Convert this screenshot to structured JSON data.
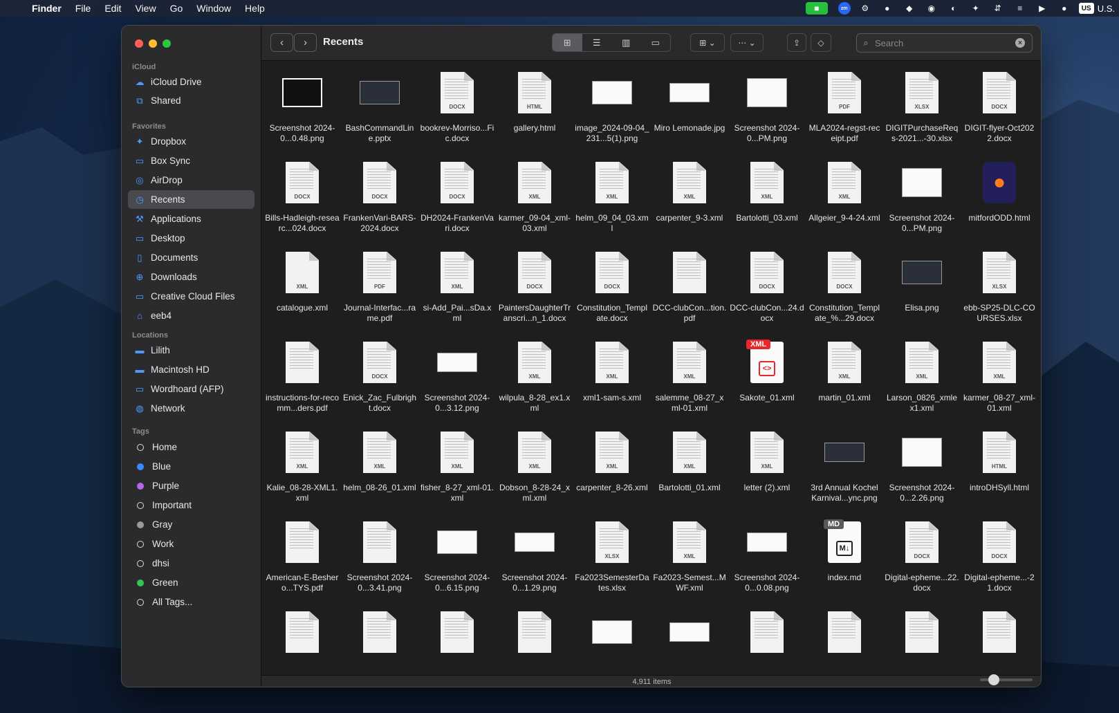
{
  "menubar": {
    "apple_icon": "apple-logo",
    "app_name": "Finder",
    "menus": [
      "File",
      "Edit",
      "View",
      "Go",
      "Window",
      "Help"
    ],
    "input_source": "U.S.",
    "input_badge": "US",
    "zoom_label": "zm"
  },
  "sidebar": {
    "icloud_title": "iCloud",
    "icloud": [
      {
        "label": "iCloud Drive",
        "icon": "☁"
      },
      {
        "label": "Shared",
        "icon": "⧉"
      }
    ],
    "favorites_title": "Favorites",
    "favorites": [
      {
        "label": "Dropbox",
        "icon": "✦"
      },
      {
        "label": "Box Sync",
        "icon": "▭"
      },
      {
        "label": "AirDrop",
        "icon": "◎"
      },
      {
        "label": "Recents",
        "icon": "◷",
        "selected": true
      },
      {
        "label": "Applications",
        "icon": "⚒"
      },
      {
        "label": "Desktop",
        "icon": "▭"
      },
      {
        "label": "Documents",
        "icon": "▯"
      },
      {
        "label": "Downloads",
        "icon": "⊕"
      },
      {
        "label": "Creative Cloud Files",
        "icon": "▭"
      },
      {
        "label": "eeb4",
        "icon": "⌂"
      }
    ],
    "locations_title": "Locations",
    "locations": [
      {
        "label": "Lilith",
        "icon": "▬"
      },
      {
        "label": "Macintosh HD",
        "icon": "▬"
      },
      {
        "label": "Wordhoard (AFP)",
        "icon": "▭"
      },
      {
        "label": "Network",
        "icon": "◍"
      }
    ],
    "tags_title": "Tags",
    "tags": [
      {
        "label": "Home",
        "color": "hollow"
      },
      {
        "label": "Blue",
        "color": "blue"
      },
      {
        "label": "Purple",
        "color": "purple"
      },
      {
        "label": "Important",
        "color": "hollow"
      },
      {
        "label": "Gray",
        "color": "gray"
      },
      {
        "label": "Work",
        "color": "hollow"
      },
      {
        "label": "dhsi",
        "color": "hollow"
      },
      {
        "label": "Green",
        "color": "green"
      },
      {
        "label": "All Tags...",
        "color": "hollow"
      }
    ]
  },
  "toolbar": {
    "title": "Recents",
    "back_icon": "‹",
    "forward_icon": "›",
    "search_placeholder": "Search"
  },
  "files": [
    {
      "name": "Screenshot 2024-0...0.48.png",
      "kind": "img-blk"
    },
    {
      "name": "BashCommandLine.pptx",
      "kind": "img-dark"
    },
    {
      "name": "bookrev-Morriso...Fic.docx",
      "kind": "doc",
      "label": "DOCX"
    },
    {
      "name": "gallery.html",
      "kind": "doc",
      "label": "HTML"
    },
    {
      "name": "image_2024-09-04_231...5(1).png",
      "kind": "img"
    },
    {
      "name": "Miro Lemonade.jpg",
      "kind": "img"
    },
    {
      "name": "Screenshot 2024-0...PM.png",
      "kind": "img"
    },
    {
      "name": "MLA2024-regst-receipt.pdf",
      "kind": "doc",
      "label": "PDF"
    },
    {
      "name": "DIGITPurchaseReqs-2021...-30.xlsx",
      "kind": "doc",
      "label": "XLSX"
    },
    {
      "name": "DIGIT-flyer-Oct2022.docx",
      "kind": "doc",
      "label": "DOCX"
    },
    {
      "name": "Bills-Hadleigh-researc...024.docx",
      "kind": "doc",
      "label": "DOCX"
    },
    {
      "name": "FrankenVari-BARS-2024.docx",
      "kind": "doc",
      "label": "DOCX"
    },
    {
      "name": "DH2024-FrankenVari.docx",
      "kind": "doc",
      "label": "DOCX"
    },
    {
      "name": "karmer_09-04_xml-03.xml",
      "kind": "doc",
      "label": "XML"
    },
    {
      "name": "helm_09_04_03.xml",
      "kind": "doc",
      "label": "XML"
    },
    {
      "name": "carpenter_9-3.xml",
      "kind": "doc",
      "label": "XML"
    },
    {
      "name": "Bartolotti_03.xml",
      "kind": "doc",
      "label": "XML"
    },
    {
      "name": "Allgeier_9-4-24.xml",
      "kind": "doc",
      "label": "XML"
    },
    {
      "name": "Screenshot 2024-0...PM.png",
      "kind": "img"
    },
    {
      "name": "mitfordODD.html",
      "kind": "fx"
    },
    {
      "name": "catalogue.xml",
      "kind": "doc-plain",
      "label": "XML"
    },
    {
      "name": "Journal-Interfac...rame.pdf",
      "kind": "doc",
      "label": "PDF"
    },
    {
      "name": "si-Add_Pai...sDa.xml",
      "kind": "doc",
      "label": "XML"
    },
    {
      "name": "PaintersDaughterTranscri...n_1.docx",
      "kind": "doc",
      "label": "DOCX"
    },
    {
      "name": "Constitution_Template.docx",
      "kind": "doc",
      "label": "DOCX"
    },
    {
      "name": "DCC-clubCon...tion.pdf",
      "kind": "doc",
      "label": ""
    },
    {
      "name": "DCC-clubCon...24.docx",
      "kind": "doc",
      "label": "DOCX"
    },
    {
      "name": "Constitution_Template_%...29.docx",
      "kind": "doc",
      "label": "DOCX"
    },
    {
      "name": "Elisa.png",
      "kind": "img-dark"
    },
    {
      "name": "ebb-SP25-DLC-COURSES.xlsx",
      "kind": "doc",
      "label": "XLSX"
    },
    {
      "name": "instructions-for-recomm...ders.pdf",
      "kind": "doc",
      "label": ""
    },
    {
      "name": "Enick_Zac_Fulbright.docx",
      "kind": "doc",
      "label": "DOCX"
    },
    {
      "name": "Screenshot 2024-0...3.12.png",
      "kind": "img"
    },
    {
      "name": "wilpula_8-28_ex1.xml",
      "kind": "doc",
      "label": "XML"
    },
    {
      "name": "xml1-sam-s.xml",
      "kind": "doc",
      "label": "XML"
    },
    {
      "name": "salemme_08-27_xml-01.xml",
      "kind": "doc",
      "label": "XML"
    },
    {
      "name": "Sakote_01.xml",
      "kind": "badge-xml",
      "label": "XML"
    },
    {
      "name": "martin_01.xml",
      "kind": "doc",
      "label": "XML"
    },
    {
      "name": "Larson_0826_xmlex1.xml",
      "kind": "doc",
      "label": "XML"
    },
    {
      "name": "karmer_08-27_xml-01.xml",
      "kind": "doc",
      "label": "XML"
    },
    {
      "name": "Kalie_08-28-XML1.xml",
      "kind": "doc",
      "label": "XML"
    },
    {
      "name": "helm_08-26_01.xml",
      "kind": "doc",
      "label": "XML"
    },
    {
      "name": "fisher_8-27_xml-01.xml",
      "kind": "doc",
      "label": "XML"
    },
    {
      "name": "Dobson_8-28-24_xml.xml",
      "kind": "doc",
      "label": "XML"
    },
    {
      "name": "carpenter_8-26.xml",
      "kind": "doc",
      "label": "XML"
    },
    {
      "name": "Bartolotti_01.xml",
      "kind": "doc",
      "label": "XML"
    },
    {
      "name": "letter (2).xml",
      "kind": "doc",
      "label": "XML"
    },
    {
      "name": "3rd Annual Kochel Karnival...ync.png",
      "kind": "img-dark"
    },
    {
      "name": "Screenshot 2024-0...2.26.png",
      "kind": "img"
    },
    {
      "name": "introDHSyll.html",
      "kind": "doc",
      "label": "HTML"
    },
    {
      "name": "American-E-Beshero...TYS.pdf",
      "kind": "doc",
      "label": ""
    },
    {
      "name": "Screenshot 2024-0...3.41.png",
      "kind": "doc",
      "label": ""
    },
    {
      "name": "Screenshot 2024-0...6.15.png",
      "kind": "img"
    },
    {
      "name": "Screenshot 2024-0...1.29.png",
      "kind": "img"
    },
    {
      "name": "Fa2023SemesterDates.xlsx",
      "kind": "doc",
      "label": "XLSX"
    },
    {
      "name": "Fa2023-Semest...MWF.xml",
      "kind": "doc",
      "label": "XML"
    },
    {
      "name": "Screenshot 2024-0...0.08.png",
      "kind": "img"
    },
    {
      "name": "index.md",
      "kind": "badge-md",
      "label": "MD"
    },
    {
      "name": "Digital-epheme...22.docx",
      "kind": "doc",
      "label": "DOCX"
    },
    {
      "name": "Digital-epheme...-21.docx",
      "kind": "doc",
      "label": "DOCX"
    },
    {
      "name": "",
      "kind": "doc",
      "label": ""
    },
    {
      "name": "",
      "kind": "doc",
      "label": ""
    },
    {
      "name": "",
      "kind": "doc",
      "label": ""
    },
    {
      "name": "",
      "kind": "doc",
      "label": ""
    },
    {
      "name": "",
      "kind": "img"
    },
    {
      "name": "",
      "kind": "img"
    },
    {
      "name": "",
      "kind": "doc",
      "label": ""
    },
    {
      "name": "",
      "kind": "doc",
      "label": ""
    },
    {
      "name": "",
      "kind": "doc",
      "label": ""
    },
    {
      "name": "",
      "kind": "doc",
      "label": ""
    }
  ],
  "status": {
    "item_count": "4,911 items"
  }
}
